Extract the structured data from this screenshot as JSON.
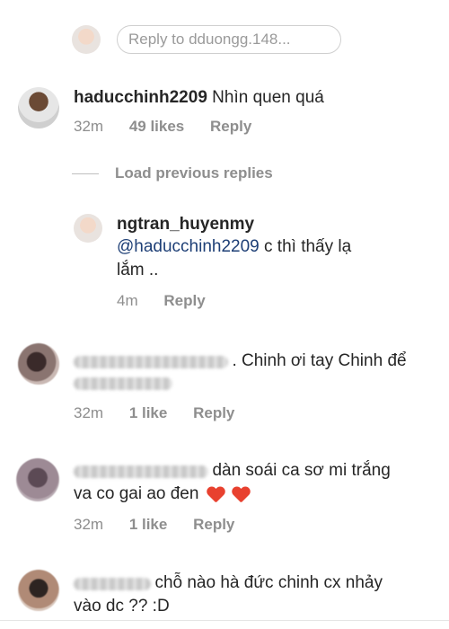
{
  "reply_bar": {
    "placeholder": "Reply to dduongg.148..."
  },
  "comments": [
    {
      "username": "haducchinh2209",
      "text": "Nhìn quen quá",
      "time": "32m",
      "likes": "49 likes",
      "reply": "Reply"
    },
    {
      "load_previous": "Load previous replies"
    },
    {
      "username": "ngtran_huyenmy",
      "mention": "@haducchinh2209",
      "text_line1": "c thì thấy lạ",
      "text_line2": "lắm ..",
      "time": "4m",
      "reply": "Reply"
    },
    {
      "text": ". Chinh ơi tay Chinh để",
      "time": "32m",
      "likes": "1 like",
      "reply": "Reply"
    },
    {
      "text_line1": "dàn soái ca sơ mi trắng",
      "text_line2": "va co gai ao đen",
      "time": "32m",
      "likes": "1 like",
      "reply": "Reply"
    },
    {
      "text_line1": "chỗ nào hà đức chinh cx nhảy",
      "text_line2": "vào dc ?? :D"
    }
  ]
}
